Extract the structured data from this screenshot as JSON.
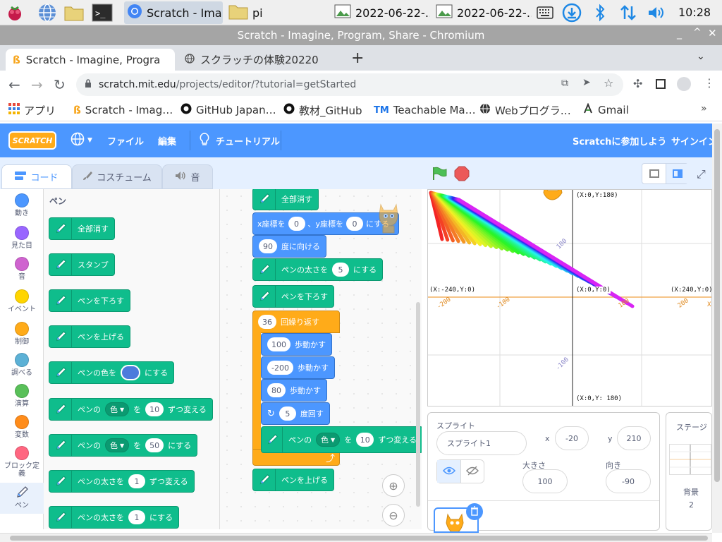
{
  "taskbar": {
    "tasks": [
      {
        "label": "Scratch - Ima…"
      },
      {
        "label": "pi"
      },
      {
        "label": "2022-06-22-…"
      },
      {
        "label": "2022-06-22-…"
      }
    ],
    "clock": "10:28"
  },
  "window": {
    "title": "Scratch - Imagine, Program, Share - Chromium"
  },
  "browser_tabs": [
    {
      "label": "Scratch - Imagine, Progra"
    },
    {
      "label": "スクラッチの体験20220"
    }
  ],
  "address": {
    "domain": "scratch.mit.edu",
    "path": "/projects/editor/?tutorial=getStarted"
  },
  "bookmarks": [
    {
      "label": "アプリ"
    },
    {
      "label": "Scratch - Imag…"
    },
    {
      "label": "GitHub Japan…"
    },
    {
      "label": "教材_GitHub"
    },
    {
      "label": "Teachable Ma…"
    },
    {
      "label": "Webプログラ…"
    },
    {
      "label": "Gmail"
    }
  ],
  "scratch_menu": {
    "logo": "SCRATCH",
    "file": "ファイル",
    "edit": "編集",
    "tutorials": "チュートリアル",
    "join": "Scratchに参加しよう",
    "signin": "サインイン"
  },
  "editor_tabs": {
    "code": "コード",
    "costumes": "コスチューム",
    "sounds": "音"
  },
  "categories": [
    {
      "label": "動き",
      "color": "#4c97ff"
    },
    {
      "label": "見た目",
      "color": "#9966ff"
    },
    {
      "label": "音",
      "color": "#cf63cf"
    },
    {
      "label": "イベント",
      "color": "#ffd500"
    },
    {
      "label": "制御",
      "color": "#ffab19"
    },
    {
      "label": "調べる",
      "color": "#5cb1d6"
    },
    {
      "label": "演算",
      "color": "#59c059"
    },
    {
      "label": "変数",
      "color": "#ff8c1a"
    },
    {
      "label": "ブロック定義",
      "color": "#ff6680"
    },
    {
      "label": "ペン",
      "color": "#0fbd8c"
    }
  ],
  "palette": {
    "title": "ペン",
    "clear": "全部消す",
    "stamp": "スタンプ",
    "pen_down": "ペンを下ろす",
    "pen_up": "ペンを上げる",
    "set_color_pre": "ペンの色を",
    "set_color_post": "にする",
    "change_param_pre": "ペンの",
    "change_param_dd": "色",
    "change_param_mid": "を",
    "change_param_val": "10",
    "change_param_post": "ずつ変える",
    "set_param_pre": "ペンの",
    "set_param_dd": "色",
    "set_param_mid": "を",
    "set_param_val": "50",
    "set_param_post": "にする",
    "change_size_pre": "ペンの太さを",
    "change_size_val": "1",
    "change_size_post": "ずつ変える",
    "set_size_pre": "ペンの太さを",
    "set_size_val": "1",
    "set_size_post": "にする"
  },
  "script": {
    "clear": "全部消す",
    "goto_x_pre": "x座標を",
    "goto_x_val": "0",
    "goto_sep": "、y座標を",
    "goto_y_val": "0",
    "goto_post": "にする",
    "point_val": "90",
    "point_post": "度に向ける",
    "size_pre": "ペンの太さを",
    "size_val": "5",
    "size_post": "にする",
    "pen_down": "ペンを下ろす",
    "repeat_val": "36",
    "repeat_label": "回繰り返す",
    "move1_val": "100",
    "move2_val": "-200",
    "move3_val": "80",
    "move_label": "歩動かす",
    "turn_val": "5",
    "turn_label": "度回す",
    "change_pre": "ペンの",
    "change_dd": "色",
    "change_mid": "を",
    "change_val": "10",
    "change_post": "ずつ変える",
    "pen_up": "ペンを上げる"
  },
  "stage": {
    "coords": {
      "top": "(X:0,Y:180)",
      "bottom": "(X:0,Y: 180)",
      "left": "(X:-240,Y:0)",
      "center": "(X:0,Y:0)",
      "right": "(X:240,Y:0)",
      "xmark": "X"
    },
    "ticks": {
      "y_pos": "100",
      "y_neg": "-100",
      "x_neg200": "-200",
      "x_neg100": "-100",
      "x_pos100": "100",
      "x_pos200": "200"
    }
  },
  "sprite_info": {
    "section": "スプライト",
    "name": "スプライト1",
    "x_label": "x",
    "x": "-20",
    "y_label": "y",
    "y": "210",
    "size_label": "大きさ",
    "size": "100",
    "direction_label": "向き",
    "direction": "-90"
  },
  "stage_panel": {
    "title": "ステージ",
    "backdrop_label": "背景",
    "backdrop_count": "2"
  }
}
